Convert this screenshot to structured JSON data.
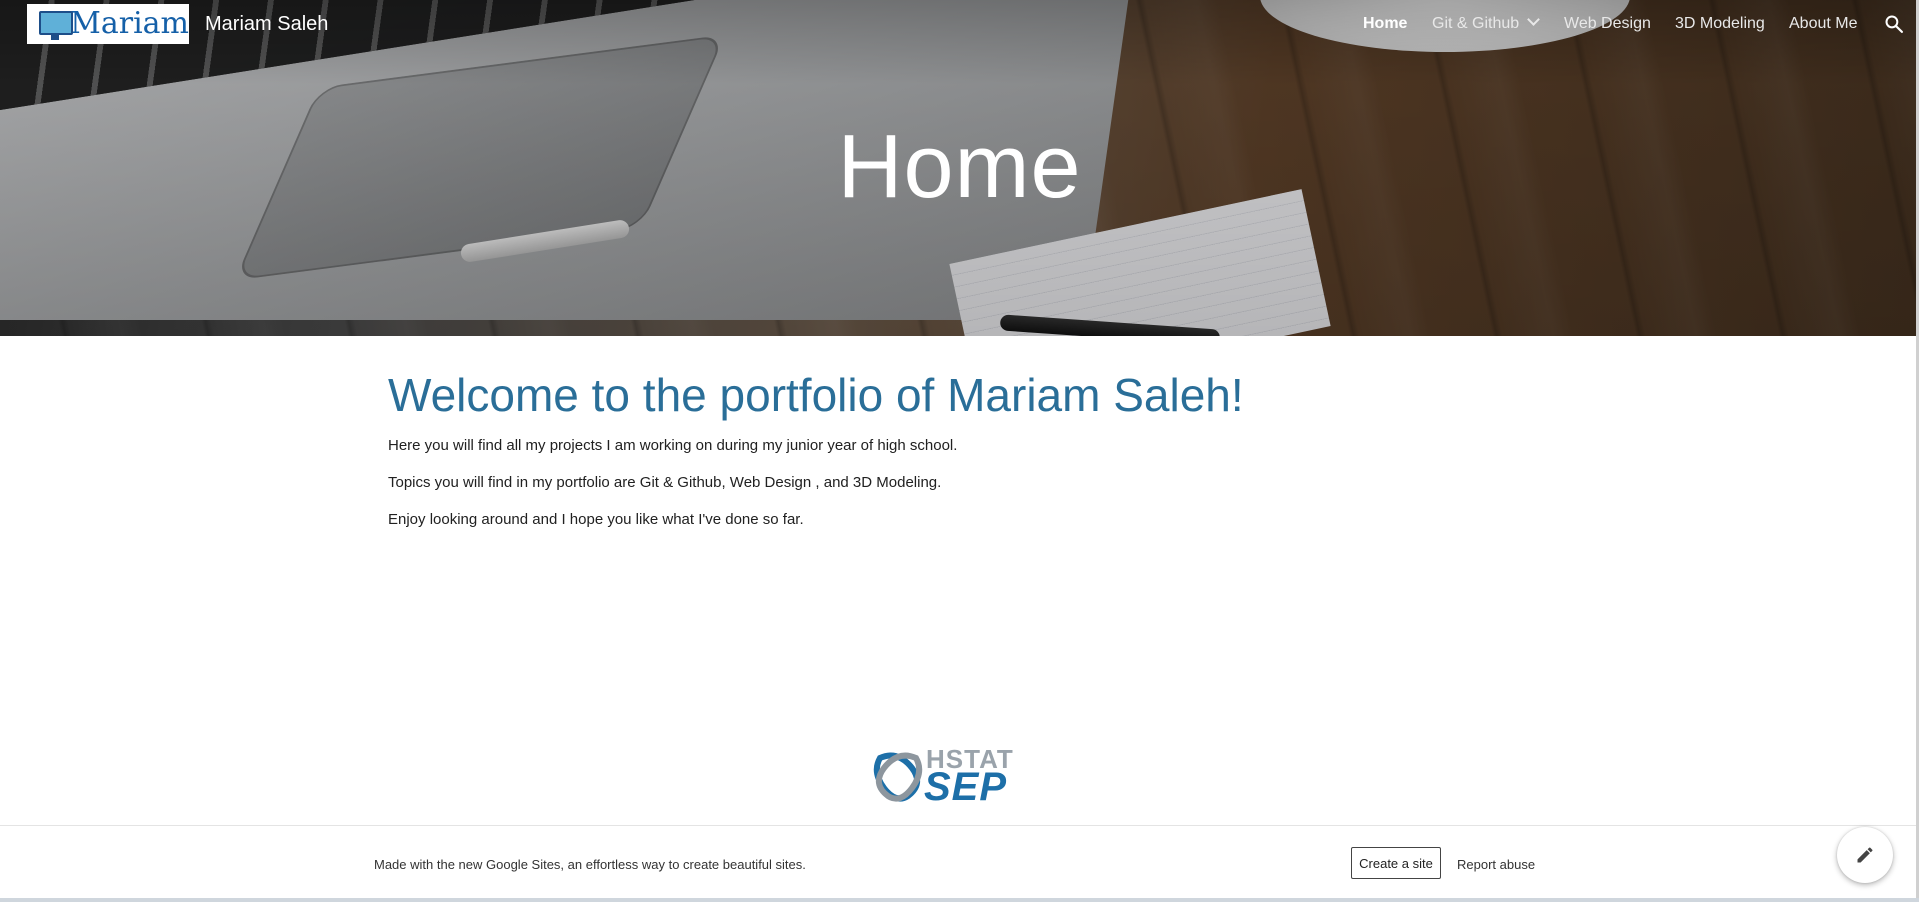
{
  "header": {
    "logo_text": "Mariam",
    "site_title": "Mariam Saleh",
    "nav": [
      {
        "label": "Home",
        "active": true
      },
      {
        "label": "Git & Github",
        "has_dropdown": true
      },
      {
        "label": "Web Design"
      },
      {
        "label": "3D Modeling"
      },
      {
        "label": "About Me"
      }
    ],
    "search_icon": "search-icon"
  },
  "hero": {
    "title": "Home"
  },
  "main": {
    "heading": "Welcome to the portfolio of Mariam Saleh!",
    "paragraphs": [
      "Here you will find all my projects I am working on during my junior year of high school.",
      "Topics you will find in my portfolio are Git & Github, Web Design , and 3D Modeling.",
      "Enjoy looking around and I hope you like what I've done so far."
    ]
  },
  "bottom_logo": {
    "top_text": "HSTAT",
    "bottom_text": "SEP"
  },
  "footer": {
    "text": "Made with the new Google Sites, an effortless way to create beautiful sites.",
    "create_label": "Create a site",
    "report_label": "Report abuse"
  },
  "colors": {
    "heading": "#2a6e98",
    "logo_blue": "#1560a8"
  }
}
